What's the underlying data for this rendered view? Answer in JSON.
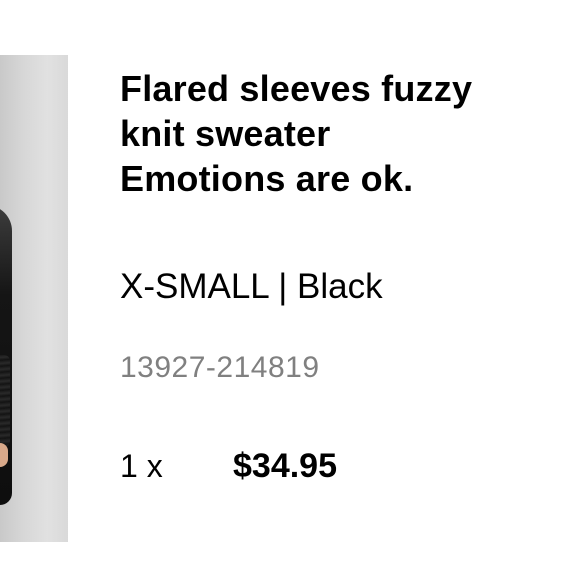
{
  "product": {
    "title_lines": [
      "Flared sleeves fuzzy",
      "knit sweater",
      "Emotions are ok."
    ],
    "size": "X-SMALL",
    "separator": "|",
    "color": "Black",
    "sku": "13927-214819",
    "quantity": "1 x",
    "price": "$34.95"
  },
  "icons": {
    "thumbnail": "product-photo"
  }
}
